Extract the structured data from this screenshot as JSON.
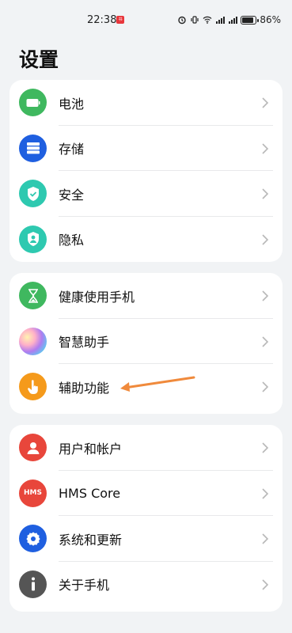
{
  "status_bar": {
    "time": "22:38",
    "notification_badge": "小红书",
    "battery_percent": "86%",
    "battery_level": 0.86
  },
  "page": {
    "title": "设置"
  },
  "groups": [
    {
      "items": [
        {
          "label": "电池",
          "icon": "battery-icon",
          "color": "#3fb85f"
        },
        {
          "label": "存储",
          "icon": "storage-icon",
          "color": "#1f5fe0"
        },
        {
          "label": "安全",
          "icon": "shield-icon",
          "color": "#2ec9b0"
        },
        {
          "label": "隐私",
          "icon": "privacy-icon",
          "color": "#2ec9b0"
        }
      ]
    },
    {
      "items": [
        {
          "label": "健康使用手机",
          "icon": "hourglass-icon",
          "color": "#3fb85f"
        },
        {
          "label": "智慧助手",
          "icon": "assistant-icon",
          "color": "gradient"
        },
        {
          "label": "辅助功能",
          "icon": "hand-icon",
          "color": "#f59a1b"
        }
      ]
    },
    {
      "items": [
        {
          "label": "用户和帐户",
          "icon": "user-icon",
          "color": "#e8463b"
        },
        {
          "label": "HMS Core",
          "icon": "hms-icon",
          "color": "#e8463b"
        },
        {
          "label": "系统和更新",
          "icon": "gear-icon",
          "color": "#1f5fe0"
        },
        {
          "label": "关于手机",
          "icon": "info-icon",
          "color": "#555555"
        }
      ]
    }
  ],
  "annotation": {
    "type": "arrow",
    "color": "#f08a3c",
    "points_to": "辅助功能"
  }
}
